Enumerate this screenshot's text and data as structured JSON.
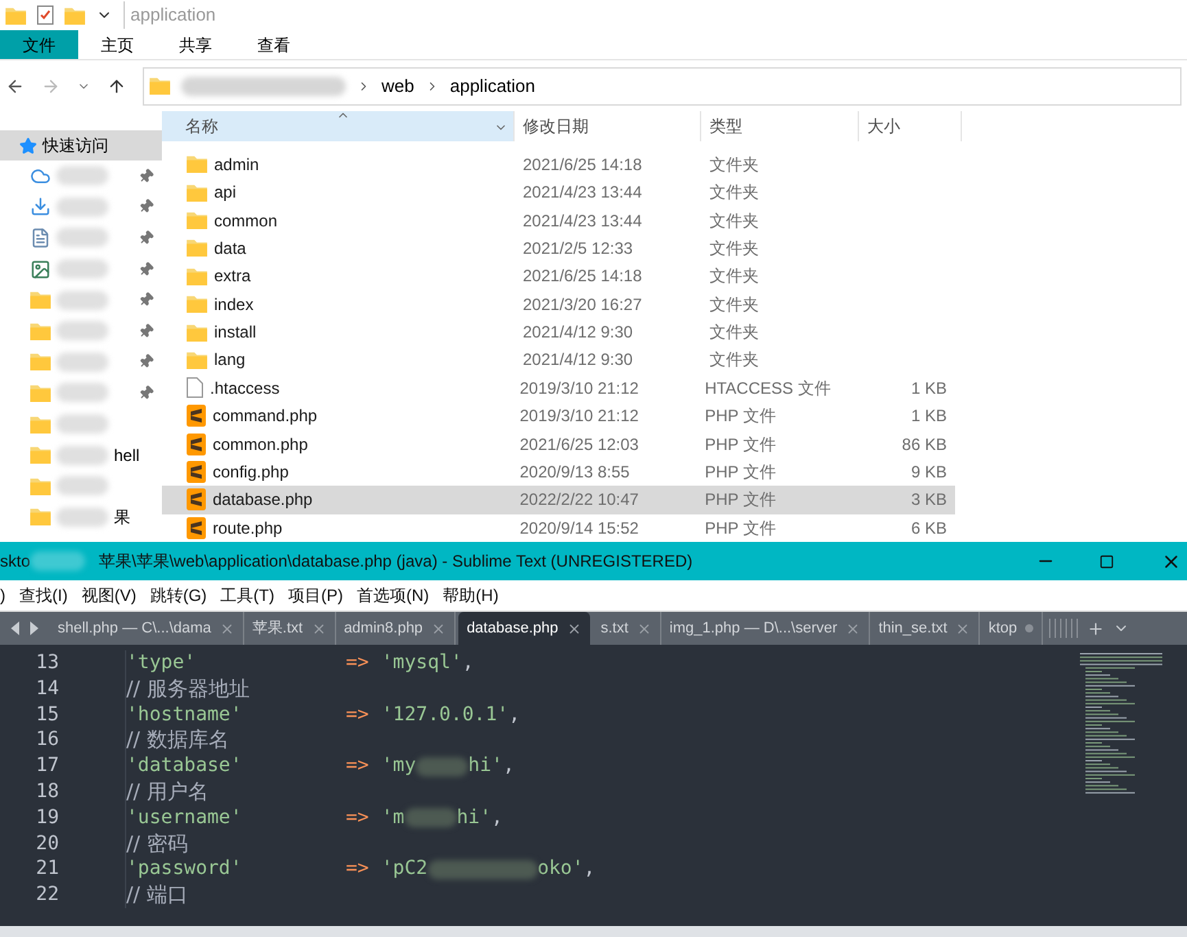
{
  "explorer": {
    "quick_toolbar_title": "application",
    "ribbon_tabs": [
      {
        "label": "文件",
        "selected": true
      },
      {
        "label": "主页",
        "selected": false
      },
      {
        "label": "共享",
        "selected": false
      },
      {
        "label": "查看",
        "selected": false
      }
    ],
    "path": [
      "web",
      "application"
    ],
    "sidebar": {
      "header": "快速访问",
      "items": [
        {
          "kind": "cloud",
          "pinned": true
        },
        {
          "kind": "download",
          "pinned": true
        },
        {
          "kind": "doc",
          "pinned": true
        },
        {
          "kind": "image",
          "pinned": true
        },
        {
          "kind": "folder",
          "pinned": true
        },
        {
          "kind": "folder",
          "pinned": true
        },
        {
          "kind": "folder",
          "pinned": true
        },
        {
          "kind": "folder",
          "pinned": true
        },
        {
          "kind": "folder",
          "pinned": false
        },
        {
          "kind": "folder",
          "pinned": false,
          "label": "hell"
        },
        {
          "kind": "folder",
          "pinned": false
        },
        {
          "kind": "folder",
          "pinned": false,
          "label": "果"
        }
      ]
    },
    "columns": [
      "名称",
      "修改日期",
      "类型",
      "大小"
    ],
    "files": [
      {
        "kind": "folder",
        "name": "admin",
        "date": "2021/6/25 14:18",
        "type": "文件夹",
        "selected": false
      },
      {
        "kind": "folder",
        "name": "api",
        "date": "2021/4/23 13:44",
        "type": "文件夹",
        "selected": false
      },
      {
        "kind": "folder",
        "name": "common",
        "date": "2021/4/23 13:44",
        "type": "文件夹",
        "selected": false
      },
      {
        "kind": "folder",
        "name": "data",
        "date": "2021/2/5 12:33",
        "type": "文件夹",
        "selected": false
      },
      {
        "kind": "folder",
        "name": "extra",
        "date": "2021/6/25 14:18",
        "type": "文件夹",
        "selected": false
      },
      {
        "kind": "folder",
        "name": "index",
        "date": "2021/3/20 16:27",
        "type": "文件夹",
        "selected": false
      },
      {
        "kind": "folder",
        "name": "install",
        "date": "2021/4/12 9:30",
        "type": "文件夹",
        "selected": false
      },
      {
        "kind": "folder",
        "name": "lang",
        "date": "2021/4/12 9:30",
        "type": "文件夹",
        "selected": false
      },
      {
        "kind": "file",
        "name": ".htaccess",
        "date": "2019/3/10 21:12",
        "type": "HTACCESS 文件",
        "size": "1 KB",
        "selected": false
      },
      {
        "kind": "php",
        "name": "command.php",
        "date": "2019/3/10 21:12",
        "type": "PHP 文件",
        "size": "1 KB",
        "selected": false
      },
      {
        "kind": "php",
        "name": "common.php",
        "date": "2021/6/25 12:03",
        "type": "PHP 文件",
        "size": "86 KB",
        "selected": false
      },
      {
        "kind": "php",
        "name": "config.php",
        "date": "2020/9/13 8:55",
        "type": "PHP 文件",
        "size": "9 KB",
        "selected": false
      },
      {
        "kind": "php",
        "name": "database.php",
        "date": "2022/2/22 10:47",
        "type": "PHP 文件",
        "size": "3 KB",
        "selected": true
      },
      {
        "kind": "php",
        "name": "route.php",
        "date": "2020/9/14 15:52",
        "type": "PHP 文件",
        "size": "6 KB",
        "selected": false
      }
    ]
  },
  "editor": {
    "title_start": "skto",
    "title": "苹果\\苹果\\web\\application\\database.php (java) - Sublime Text (UNREGISTERED)",
    "menu": [
      ")",
      "查找(I)",
      "视图(V)",
      "跳转(G)",
      "工具(T)",
      "项目(P)",
      "首选项(N)",
      "帮助(H)"
    ],
    "tabs": [
      {
        "label": "shell.php — C\\...\\dama",
        "selected": false,
        "dirty": false
      },
      {
        "label": "苹果.txt",
        "selected": false,
        "dirty": false
      },
      {
        "label": "admin8.php",
        "selected": false,
        "dirty": false
      },
      {
        "label": "database.php",
        "selected": true,
        "dirty": false
      },
      {
        "label": "s.txt",
        "selected": false,
        "dirty": false
      },
      {
        "label": "img_1.php — D\\...\\server",
        "selected": false,
        "dirty": false
      },
      {
        "label": "thin_se.txt",
        "selected": false,
        "dirty": false
      },
      {
        "label": "ktop",
        "selected": false,
        "dirty": true
      }
    ],
    "lines": [
      {
        "num": "13",
        "kind": "pair",
        "key": "'type'",
        "arrow": "=>",
        "value": [
          "'mysql'"
        ],
        "end": ","
      },
      {
        "num": "14",
        "kind": "comment",
        "text": "// 服务器地址"
      },
      {
        "num": "15",
        "kind": "pair",
        "key": "'hostname'",
        "arrow": "=>",
        "value": [
          "'127.0.0.1'"
        ],
        "end": ","
      },
      {
        "num": "16",
        "kind": "comment",
        "text": "// 数据库名"
      },
      {
        "num": "17",
        "kind": "pair",
        "key": "'database'",
        "arrow": "=>",
        "value": [
          "'my",
          "hi'"
        ],
        "end": ","
      },
      {
        "num": "18",
        "kind": "comment",
        "text": "// 用户名"
      },
      {
        "num": "19",
        "kind": "pair",
        "key": "'username'",
        "arrow": "=>",
        "value": [
          "'m",
          "hi'"
        ],
        "end": ","
      },
      {
        "num": "20",
        "kind": "comment",
        "text": "// 密码"
      },
      {
        "num": "21",
        "kind": "pair",
        "key": "'password'",
        "arrow": "=>",
        "value": [
          "'pC2",
          "oko'"
        ],
        "end": ","
      },
      {
        "num": "22",
        "kind": "comment",
        "text": "// 端口"
      }
    ]
  }
}
